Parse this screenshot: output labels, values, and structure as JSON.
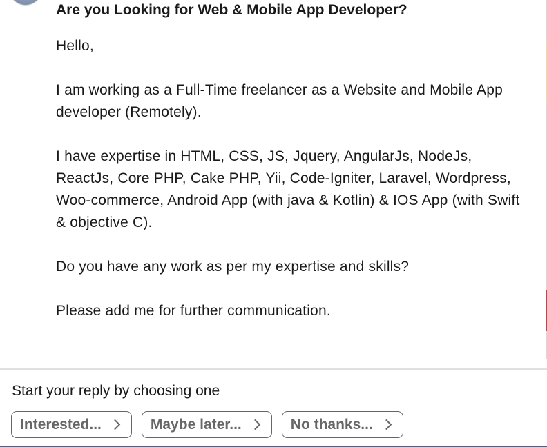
{
  "message": {
    "subject": "Are you Looking for Web & Mobile App Developer?",
    "paragraphs": [
      "Hello,",
      "I am working as a Full-Time freelancer as a Website and Mobile App developer (Remotely).",
      "I have expertise in HTML, CSS, JS, Jquery, AngularJs, NodeJs, ReactJs, Core PHP, Cake PHP, Yii, Code-Igniter, Laravel, Wordpress, Woo-commerce, Android App (with java & Kotlin) & IOS App (with Swift & objective C).",
      "Do you have any work as per my expertise and skills?",
      "Please add me for further communication."
    ]
  },
  "reply": {
    "prompt": "Start your reply by choosing one",
    "options": [
      {
        "label": "Interested..."
      },
      {
        "label": "Maybe later..."
      },
      {
        "label": "No thanks..."
      }
    ]
  },
  "icons": {
    "chip_chevron": "chevron-right-icon"
  }
}
